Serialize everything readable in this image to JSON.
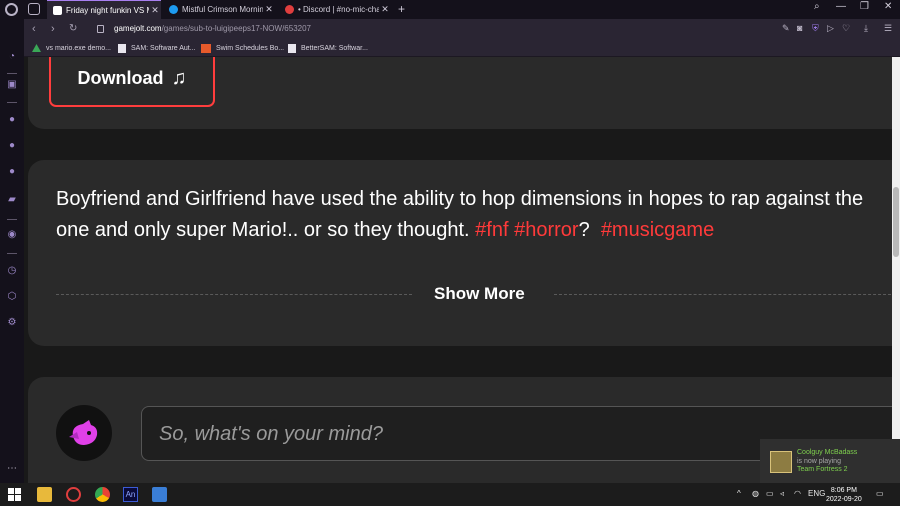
{
  "browser": {
    "tabs": [
      {
        "title": "Friday night funkin VS Mar",
        "active": true
      },
      {
        "title": "Mistful Crimson Morning (",
        "active": false
      },
      {
        "title": "• Discord | #no-mic-chat | ",
        "active": false
      }
    ],
    "url_host": "gamejolt.com",
    "url_path": "/games/sub-to-luigipeeps17-NOW/653207",
    "bookmarks": [
      "vs mario.exe demo...",
      "SAM: Software Aut...",
      "Swim Schedules Bo...",
      "BetterSAM: Softwar..."
    ]
  },
  "page": {
    "download_label": "Download",
    "description": "Boyfriend and Girlfriend have used the ability to hop dimensions in hopes to rap against the one and only super Mario!.. or so they thought.",
    "tags": [
      "#fnf",
      "#horror",
      "#musicgame"
    ],
    "tag_separator_after_second": "?",
    "show_more_label": "Show More",
    "comment_placeholder": "So, what's on your mind?"
  },
  "notification": {
    "name": "Coolguy McBadass",
    "status": "is now playing",
    "game": "Team Fortress 2"
  },
  "taskbar": {
    "language": "ENG",
    "time": "8:06 PM",
    "date": "2022-09-20"
  },
  "colors": {
    "accent_red": "#ff3a3a",
    "browser_accent": "#a87ff0",
    "card_bg": "#2a2a2a"
  }
}
